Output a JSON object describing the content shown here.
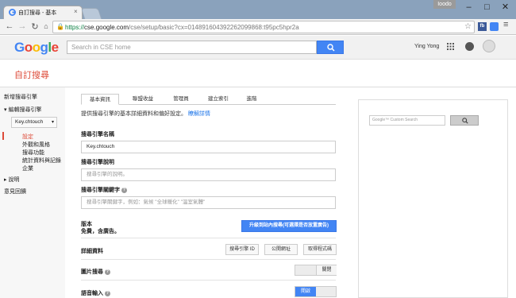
{
  "browser": {
    "tab_title": "自訂搜尋 - 基本",
    "user_chip": "Ioodo",
    "url_scheme": "https://",
    "url_host": "cse.google.com",
    "url_path": "/cse/setup/basic?cx=014891604392262099868:t95pc5hpr2a",
    "ext_fb": "fb"
  },
  "header": {
    "logo_letters": [
      {
        "ch": "G",
        "color": "#4285f4"
      },
      {
        "ch": "o",
        "color": "#ea4335"
      },
      {
        "ch": "o",
        "color": "#fbbc05"
      },
      {
        "ch": "g",
        "color": "#4285f4"
      },
      {
        "ch": "l",
        "color": "#34a853"
      },
      {
        "ch": "e",
        "color": "#ea4335"
      }
    ],
    "search_placeholder": "Search in CSE home",
    "user_name": "Ying Yong"
  },
  "page_title": "自訂搜尋",
  "sidebar": {
    "new_engine": "新增搜尋引擎",
    "edit_engine": "編輯搜尋引擎",
    "engine_select": "Key.chtouch",
    "items": [
      "設定",
      "外觀和風格",
      "搜尋功能",
      "統計資料與記錄",
      "企業"
    ],
    "help": "說明",
    "feedback": "意見回饋"
  },
  "tabs": [
    "基本資訊",
    "聯盟收益",
    "管理員",
    "建立索引",
    "進階"
  ],
  "main": {
    "description": "提供搜尋引擎的基本詳細資料和偏好設定。",
    "learn_more": "瞭解詳情",
    "name_label": "搜尋引擎名稱",
    "name_value": "Key.chtouch",
    "desc_label": "搜尋引擎說明",
    "desc_placeholder": "搜尋引擎的說明。",
    "keywords_label": "搜尋引擎關鍵字",
    "keywords_placeholder": "搜尋引擎關鍵字，例如：氣候 \"全球暖化\" \"溫室氣體\"",
    "edition_label": "版本",
    "edition_value": "免費，含廣告。",
    "upgrade_button": "升級到站內搜尋(可選擇是否放置廣告)",
    "details_label": "詳細資料",
    "engine_id_button": "搜尋引擎 ID",
    "public_url_button": "公開網址",
    "get_code_button": "取得程式碼",
    "image_search_label": "圖片搜尋",
    "image_search_state": "關閉",
    "speech_input_label": "語音輸入",
    "speech_input_state": "開啟"
  },
  "preview": {
    "input_placeholder": "Custom Search",
    "google_mark": "Google™"
  },
  "colors": {
    "accent_red": "#dd4b39",
    "accent_blue": "#4285f4",
    "link_blue": "#1a73e8"
  }
}
